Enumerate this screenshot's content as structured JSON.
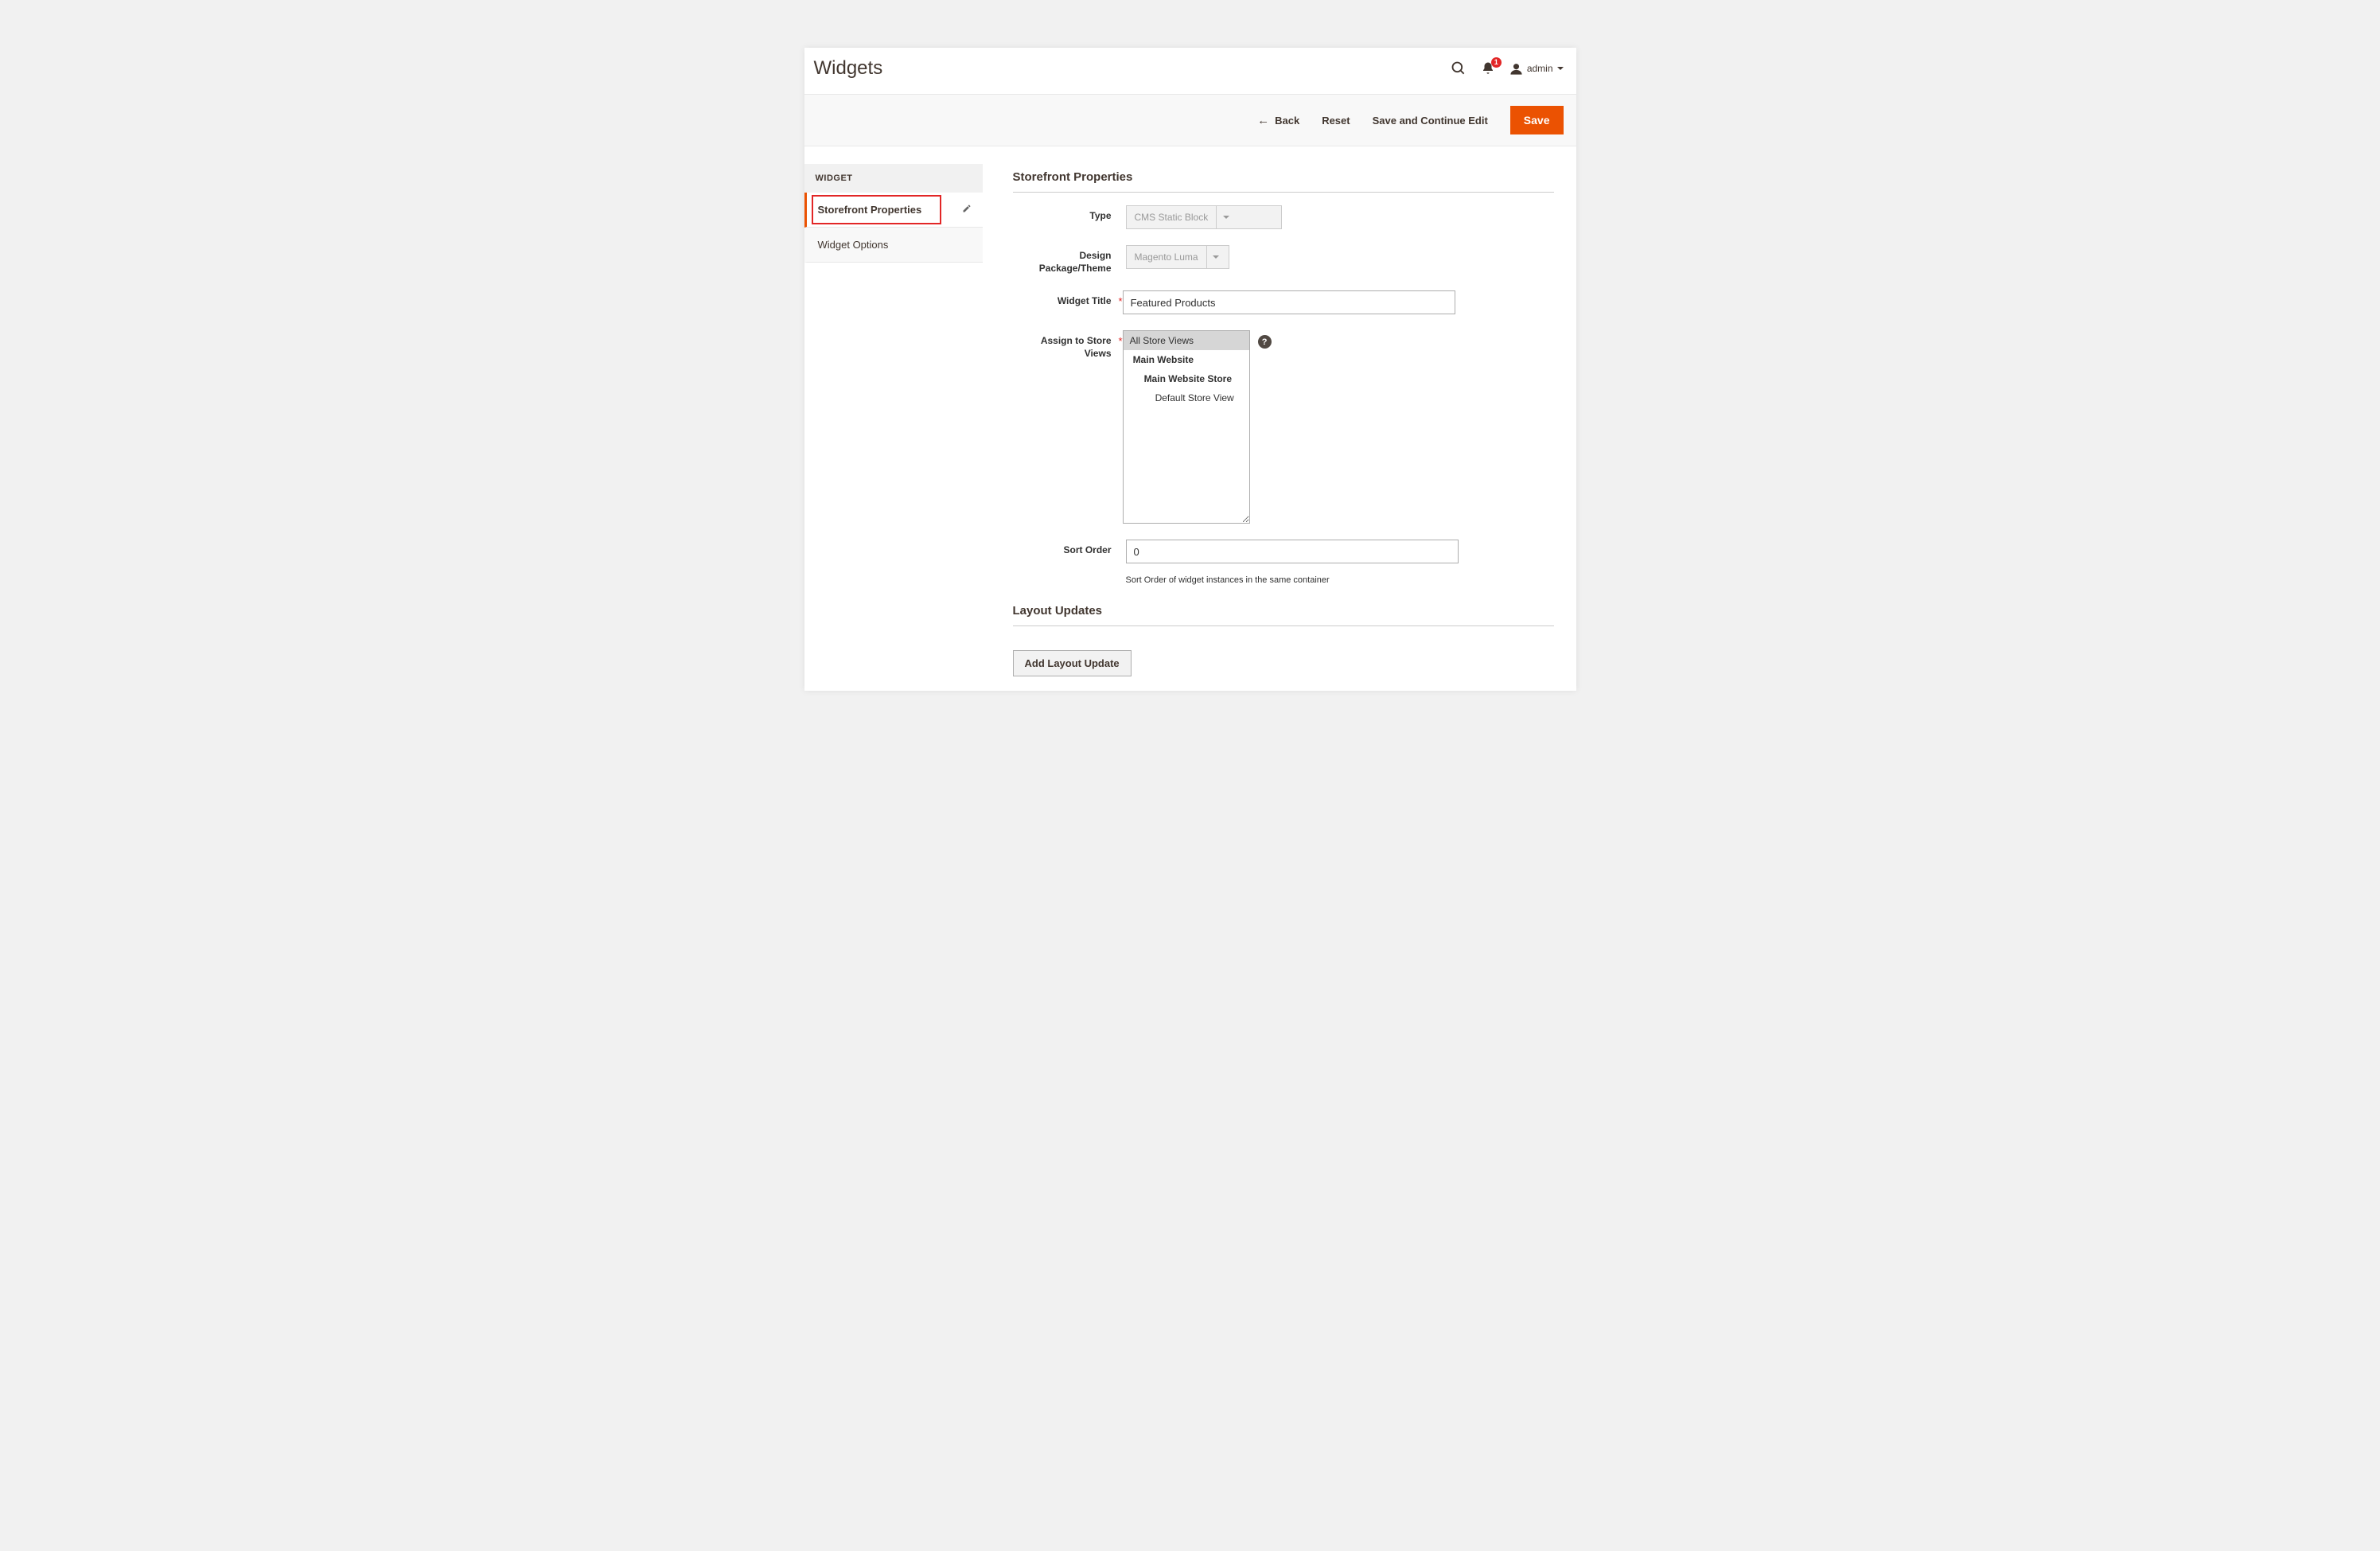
{
  "header": {
    "title": "Widgets",
    "notif_count": "1",
    "user": "admin"
  },
  "actions": {
    "back": "Back",
    "reset": "Reset",
    "save_continue": "Save and Continue Edit",
    "save": "Save"
  },
  "sidebar": {
    "heading": "WIDGET",
    "items": [
      {
        "label": "Storefront Properties"
      },
      {
        "label": "Widget Options"
      }
    ]
  },
  "form": {
    "section_title": "Storefront Properties",
    "type_label": "Type",
    "type_value": "CMS Static Block",
    "theme_label": "Design Package/Theme",
    "theme_value": "Magento Luma",
    "title_label": "Widget Title",
    "title_value": "Featured Products",
    "stores_label": "Assign to Store Views",
    "stores_options": {
      "all": "All Store Views",
      "main_website": "Main Website",
      "main_store": "Main Website Store",
      "default_view": "Default Store View"
    },
    "sort_label": "Sort Order",
    "sort_value": "0",
    "sort_note": "Sort Order of widget instances in the same container"
  },
  "layout": {
    "section_title": "Layout Updates",
    "add_button": "Add Layout Update"
  }
}
